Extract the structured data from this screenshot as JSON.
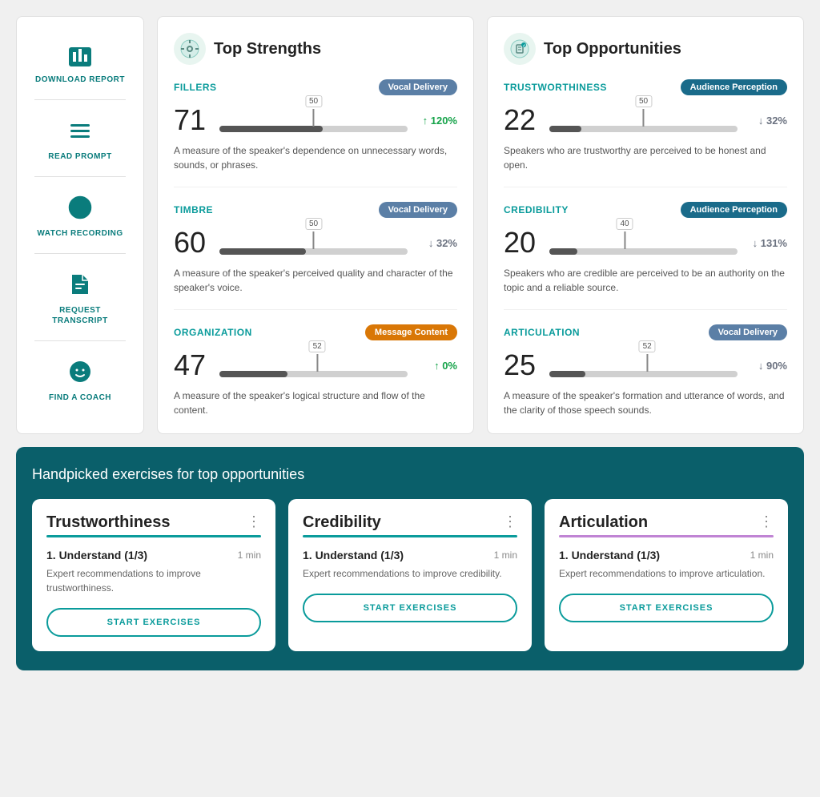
{
  "sidebar": {
    "items": [
      {
        "id": "download-report",
        "label": "DOWNLOAD\nREPORT",
        "icon": "bar-chart"
      },
      {
        "id": "read-prompt",
        "label": "READ\nPROMPT",
        "icon": "lines"
      },
      {
        "id": "watch-recording",
        "label": "WATCH\nRECORDING",
        "icon": "play-circle"
      },
      {
        "id": "request-transcript",
        "label": "REQUEST\nTRANSCRIPT",
        "icon": "document"
      },
      {
        "id": "find-coach",
        "label": "FIND A\nCOACH",
        "icon": "face"
      }
    ]
  },
  "strengths": {
    "title": "Top Strengths",
    "metrics": [
      {
        "name": "FILLERS",
        "badge": "Vocal Delivery",
        "badge_type": "vocal",
        "score": "71",
        "marker": 50,
        "fill_pct": 55,
        "change": "↑ 120%",
        "change_type": "up",
        "desc": "A measure of the speaker's dependence on unnecessary words, sounds, or phrases."
      },
      {
        "name": "TIMBRE",
        "badge": "Vocal Delivery",
        "badge_type": "vocal",
        "score": "60",
        "marker": 50,
        "fill_pct": 46,
        "change": "↓ 32%",
        "change_type": "down",
        "desc": "A measure of the speaker's perceived quality and character of the speaker's voice."
      },
      {
        "name": "ORGANIZATION",
        "badge": "Message Content",
        "badge_type": "message",
        "score": "47",
        "marker": 52,
        "fill_pct": 36,
        "change": "↑ 0%",
        "change_type": "up",
        "desc": "A measure of the speaker's logical structure and flow of the content."
      }
    ]
  },
  "opportunities": {
    "title": "Top Opportunities",
    "metrics": [
      {
        "name": "TRUSTWORTHINESS",
        "badge": "Audience Perception",
        "badge_type": "audience",
        "score": "22",
        "marker": 50,
        "fill_pct": 17,
        "change": "↓ 32%",
        "change_type": "down",
        "desc": "Speakers who are trustworthy are perceived to be honest and open."
      },
      {
        "name": "CREDIBILITY",
        "badge": "Audience Perception",
        "badge_type": "audience",
        "score": "20",
        "marker": 40,
        "fill_pct": 15,
        "change": "↓ 131%",
        "change_type": "down",
        "desc": "Speakers who are credible are perceived to be an authority on the topic and a reliable source."
      },
      {
        "name": "ARTICULATION",
        "badge": "Vocal Delivery",
        "badge_type": "vocal",
        "score": "25",
        "marker": 52,
        "fill_pct": 19,
        "change": "↓ 90%",
        "change_type": "down",
        "desc": "A measure of the speaker's formation and utterance of words, and the clarity of those speech sounds."
      }
    ]
  },
  "exercises": {
    "section_title": "Handpicked exercises for top opportunities",
    "cards": [
      {
        "title": "Trustworthiness",
        "accent": "teal",
        "step": "1. Understand (1/3)",
        "time": "1 min",
        "desc": "Expert recommendations to improve trustworthiness.",
        "btn": "START EXERCISES"
      },
      {
        "title": "Credibility",
        "accent": "blue",
        "step": "1. Understand (1/3)",
        "time": "1 min",
        "desc": "Expert recommendations to improve credibility.",
        "btn": "START EXERCISES"
      },
      {
        "title": "Articulation",
        "accent": "purple",
        "step": "1. Understand (1/3)",
        "time": "1 min",
        "desc": "Expert recommendations to improve articulation.",
        "btn": "START EXERCISES"
      }
    ]
  }
}
